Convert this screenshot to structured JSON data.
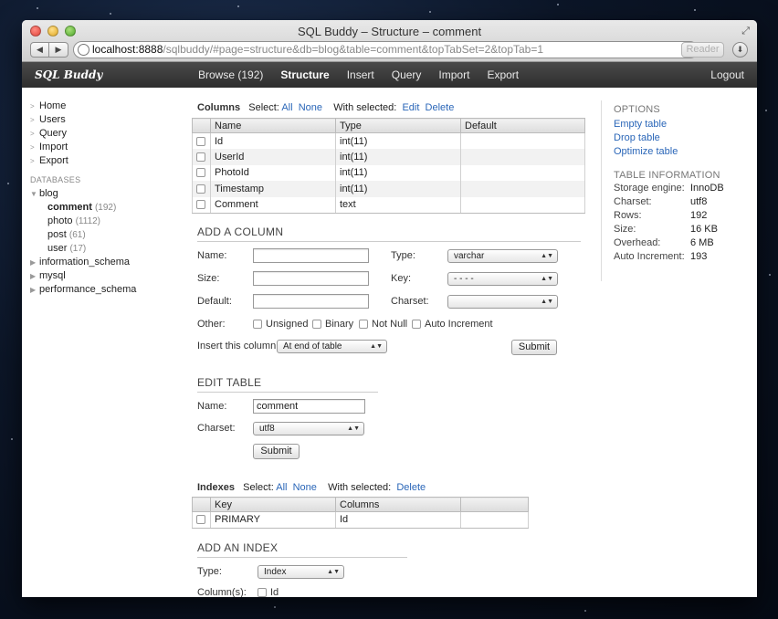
{
  "browser": {
    "title": "SQL Buddy – Structure – comment",
    "url_host": "localhost:8888",
    "url_path": "/sqlbuddy/#page=structure&db=blog&table=comment&topTabSet=2&topTab=1",
    "reader_label": "Reader"
  },
  "app": {
    "logo": "SQL Buddy",
    "nav": [
      {
        "label": "Browse (192)",
        "active": false
      },
      {
        "label": "Structure",
        "active": true
      },
      {
        "label": "Insert",
        "active": false
      },
      {
        "label": "Query",
        "active": false
      },
      {
        "label": "Import",
        "active": false
      },
      {
        "label": "Export",
        "active": false
      }
    ],
    "logout": "Logout"
  },
  "sidebar": {
    "links": [
      "Home",
      "Users",
      "Query",
      "Import",
      "Export"
    ],
    "databases_heading": "DATABASES",
    "blog": "blog",
    "tables": [
      {
        "name": "comment",
        "count": "(192)",
        "active": true
      },
      {
        "name": "photo",
        "count": "(1112)",
        "active": false
      },
      {
        "name": "post",
        "count": "(61)",
        "active": false
      },
      {
        "name": "user",
        "count": "(17)",
        "active": false
      }
    ],
    "other_dbs": [
      "information_schema",
      "mysql",
      "performance_schema"
    ]
  },
  "columns_bar": {
    "title": "Columns",
    "select_label": "Select:",
    "all": "All",
    "none": "None",
    "with_selected": "With selected:",
    "edit": "Edit",
    "delete": "Delete"
  },
  "columns_table": {
    "headers": [
      "Name",
      "Type",
      "Default"
    ],
    "rows": [
      {
        "name": "Id",
        "type": "int(11)",
        "default": ""
      },
      {
        "name": "UserId",
        "type": "int(11)",
        "default": ""
      },
      {
        "name": "PhotoId",
        "type": "int(11)",
        "default": ""
      },
      {
        "name": "Timestamp",
        "type": "int(11)",
        "default": ""
      },
      {
        "name": "Comment",
        "type": "text",
        "default": ""
      }
    ]
  },
  "add_column": {
    "title": "ADD A COLUMN",
    "name_label": "Name:",
    "size_label": "Size:",
    "default_label": "Default:",
    "type_label": "Type:",
    "type_value": "varchar",
    "key_label": "Key:",
    "key_value": "- - - -",
    "charset_label": "Charset:",
    "charset_value": "",
    "other_label": "Other:",
    "other_options": [
      "Unsigned",
      "Binary",
      "Not Null",
      "Auto Increment"
    ],
    "insert_label": "Insert this column:",
    "insert_value": "At end of table",
    "submit": "Submit"
  },
  "edit_table": {
    "title": "EDIT TABLE",
    "name_label": "Name:",
    "name_value": "comment",
    "charset_label": "Charset:",
    "charset_value": "utf8",
    "submit": "Submit"
  },
  "indexes_bar": {
    "title": "Indexes",
    "select_label": "Select:",
    "all": "All",
    "none": "None",
    "with_selected": "With selected:",
    "delete": "Delete"
  },
  "indexes_table": {
    "headers": [
      "Key",
      "Columns"
    ],
    "rows": [
      {
        "key": "PRIMARY",
        "columns": "Id"
      }
    ]
  },
  "add_index": {
    "title": "ADD AN INDEX",
    "type_label": "Type:",
    "type_value": "Index",
    "columns_label": "Column(s):",
    "column_option": "Id"
  },
  "options": {
    "title": "OPTIONS",
    "links": [
      "Empty table",
      "Drop table",
      "Optimize table"
    ]
  },
  "table_info": {
    "title": "TABLE INFORMATION",
    "rows": [
      {
        "k": "Storage engine:",
        "v": "InnoDB"
      },
      {
        "k": "Charset:",
        "v": "utf8"
      },
      {
        "k": "Rows:",
        "v": "192"
      },
      {
        "k": "Size:",
        "v": "16 KB"
      },
      {
        "k": "Overhead:",
        "v": "6 MB"
      },
      {
        "k": "Auto Increment:",
        "v": "193"
      }
    ]
  }
}
